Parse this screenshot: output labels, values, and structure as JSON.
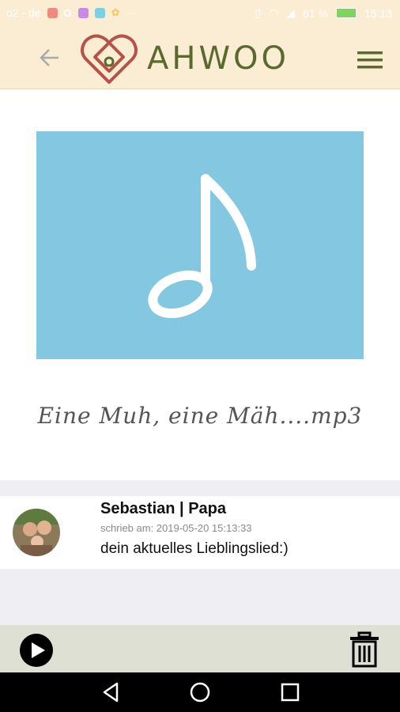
{
  "status_bar": {
    "carrier": "o2 - de",
    "battery": "61 %",
    "time": "15:13",
    "icons": [
      "message-icon",
      "google-icon",
      "notes-app-icon",
      "screen-app-icon",
      "photos-app-icon",
      "more-dots-icon",
      "vibrate-icon",
      "wifi-icon",
      "signal-icon",
      "battery-icon"
    ]
  },
  "header": {
    "brand": "AHWOO",
    "back_icon": "back-arrow-icon",
    "menu_icon": "hamburger-menu-icon",
    "bg_color": "#fbedd3",
    "brand_color": "#5a6a2f",
    "logo_color": "#b5524a"
  },
  "media": {
    "title": "Eine Muh, eine Mäh....mp3",
    "thumbnail_icon": "music-note-icon",
    "thumbnail_color": "#83c8e0"
  },
  "comment": {
    "author": "Sebastian | Papa",
    "date": "schrieb am: 2019-05-20 15:13:33",
    "text": "dein aktuelles Lieblingslied:)"
  },
  "player": {
    "play_icon": "play-icon",
    "delete_icon": "trash-icon"
  },
  "nav": {
    "back": "nav-back-icon",
    "home": "nav-home-icon",
    "recents": "nav-recents-icon"
  }
}
